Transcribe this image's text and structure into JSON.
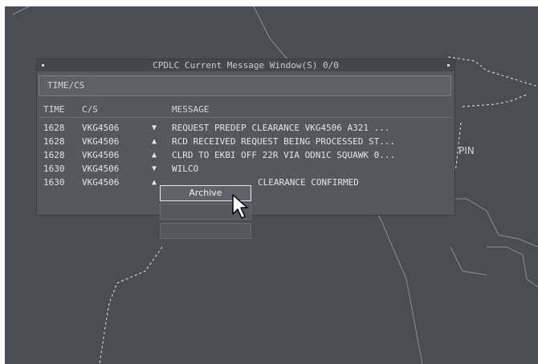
{
  "window": {
    "title": "CPDLC Current Message Window(S) 0/0",
    "filter_label": "TIME/CS",
    "columns": {
      "time": "TIME",
      "callsign": "C/S",
      "message": "MESSAGE"
    }
  },
  "messages": [
    {
      "time": "1628",
      "callsign": "VKG4506",
      "direction": "▼",
      "text": "REQUEST PREDEP CLEARANCE  VKG4506 A321 ..."
    },
    {
      "time": "1628",
      "callsign": "VKG4506",
      "direction": "▲",
      "text": "RCD RECEIVED REQUEST BEING PROCESSED ST..."
    },
    {
      "time": "1628",
      "callsign": "VKG4506",
      "direction": "▲",
      "text": "CLRD TO EKBI OFF 22R VIA ODN1C SQUAWK 0..."
    },
    {
      "time": "1630",
      "callsign": "VKG4506",
      "direction": "▼",
      "text": "WILCO"
    },
    {
      "time": "1630",
      "callsign": "VKG4506",
      "direction": "▲",
      "text": "CLEARANCE CONFIRMED"
    }
  ],
  "context_menu": {
    "items": [
      {
        "label": "Archive",
        "enabled": true
      },
      {
        "label": "",
        "enabled": false
      },
      {
        "label": "",
        "enabled": false
      }
    ]
  },
  "map": {
    "label": "PIN"
  },
  "colors": {
    "background": "#4a4d52",
    "window": "#54585d",
    "text": "#e2e4e6",
    "dashed_line": "#e8e8e8",
    "coastline": "#8a8d91"
  }
}
